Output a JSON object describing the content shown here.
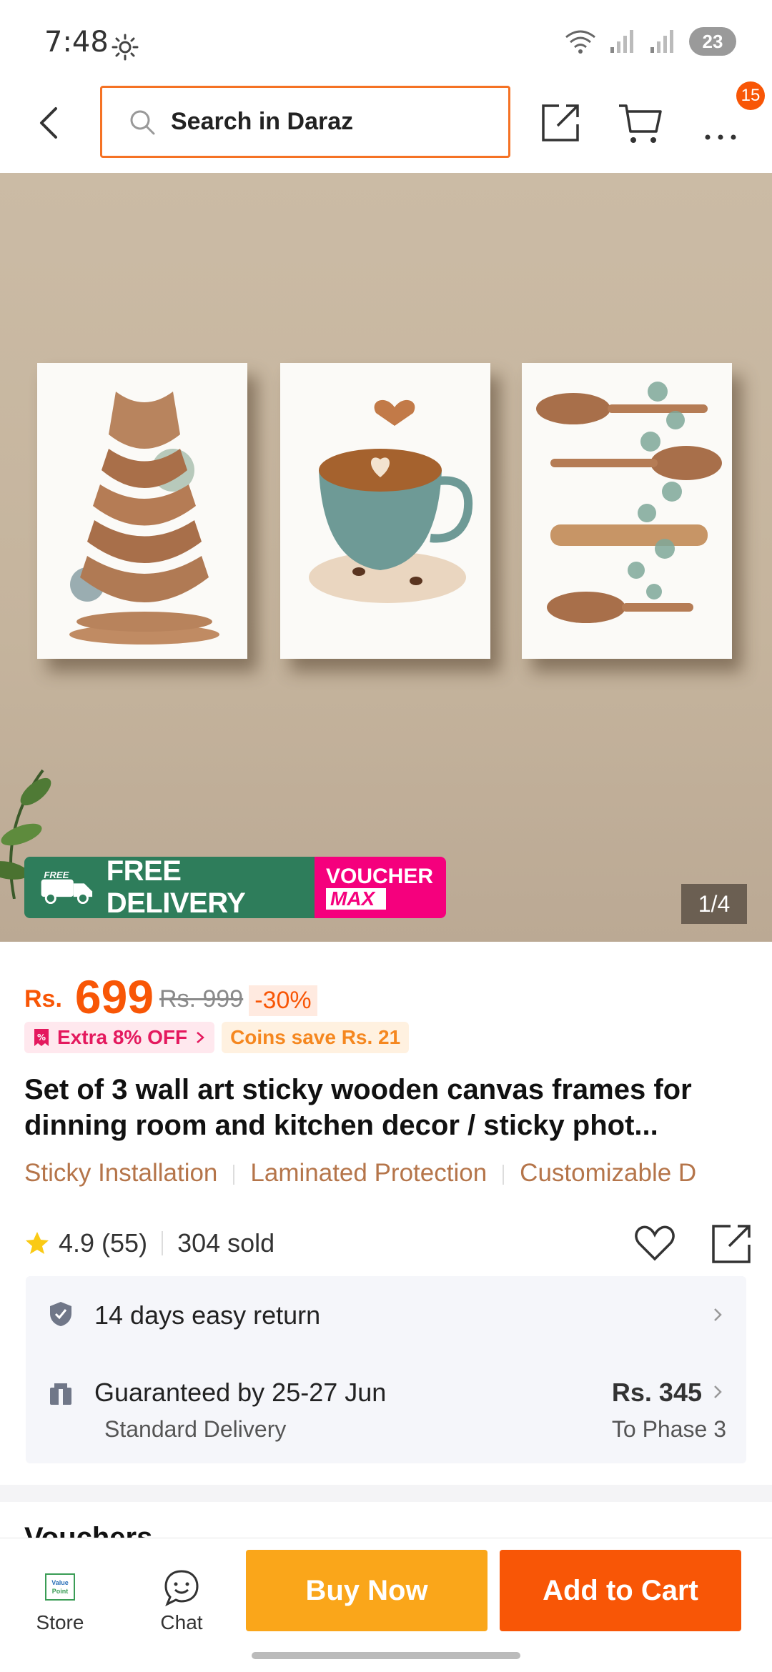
{
  "status_bar": {
    "time": "7:48",
    "battery": "23"
  },
  "header": {
    "search_placeholder": "Search in Daraz",
    "cart_badge": "15"
  },
  "gallery": {
    "counter": "1/4",
    "promo_free": "FREE",
    "promo_delivery": "FREE DELIVERY",
    "promo_voucher": "VOUCHER",
    "promo_max": "MAX"
  },
  "price": {
    "currency": "Rs.",
    "current": "699",
    "original": "Rs. 999",
    "discount": "-30%"
  },
  "promos": {
    "extra": "Extra 8% OFF",
    "coins": "Coins save Rs. 21"
  },
  "product": {
    "title": "Set of 3 wall art sticky wooden canvas frames for dinning room and kitchen decor / sticky phot...",
    "features": [
      "Sticky Installation",
      "Laminated Protection",
      "Customizable D"
    ]
  },
  "rating": {
    "value": "4.9 (55)",
    "sold": "304 sold"
  },
  "services": {
    "return": "14 days easy return",
    "delivery": "Guaranteed by 25-27 Jun",
    "delivery_type": "Standard Delivery",
    "delivery_fee": "Rs. 345",
    "delivery_to": "To Phase 3"
  },
  "next_section": "Vouchers",
  "bottom_bar": {
    "store": "Store",
    "chat": "Chat",
    "buy_now": "Buy Now",
    "add_to_cart": "Add to Cart",
    "store_logo": "Value Point"
  },
  "colors": {
    "brand_orange": "#f85606",
    "buy_yellow": "#faa61a",
    "delivery_green": "#2e7d5b",
    "voucher_pink": "#f5007d"
  }
}
